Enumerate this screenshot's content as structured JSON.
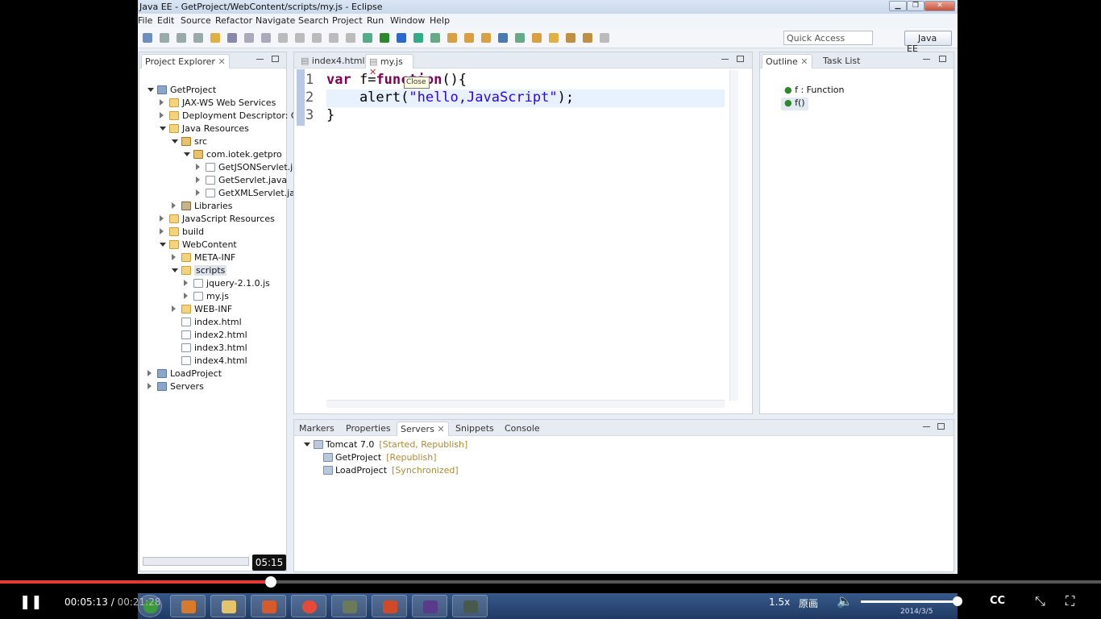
{
  "window": {
    "title": "Java EE - GetProject/WebContent/scripts/my.js - Eclipse"
  },
  "menu": [
    "File",
    "Edit",
    "Source",
    "Refactor",
    "Navigate",
    "Search",
    "Project",
    "Run",
    "Window",
    "Help"
  ],
  "toolbar": {
    "quick_access_placeholder": "Quick Access",
    "perspective": "Java EE"
  },
  "project_explorer": {
    "tab": "Project Explorer",
    "tree": [
      {
        "label": "GetProject",
        "level": 0,
        "open": true,
        "icon": "project"
      },
      {
        "label": "JAX-WS Web Services",
        "level": 1,
        "open": false,
        "icon": "folder"
      },
      {
        "label": "Deployment Descriptor: Ge",
        "level": 1,
        "open": false,
        "icon": "folder"
      },
      {
        "label": "Java Resources",
        "level": 1,
        "open": true,
        "icon": "folder"
      },
      {
        "label": "src",
        "level": 2,
        "open": true,
        "icon": "package-folder"
      },
      {
        "label": "com.iotek.getpro",
        "level": 3,
        "open": true,
        "icon": "package"
      },
      {
        "label": "GetJSONServlet.ja",
        "level": 4,
        "open": false,
        "icon": "file"
      },
      {
        "label": "GetServlet.java",
        "level": 4,
        "open": false,
        "icon": "file"
      },
      {
        "label": "GetXMLServlet.jav",
        "level": 4,
        "open": false,
        "icon": "file"
      },
      {
        "label": "Libraries",
        "level": 2,
        "open": false,
        "icon": "library"
      },
      {
        "label": "JavaScript Resources",
        "level": 1,
        "open": false,
        "icon": "folder"
      },
      {
        "label": "build",
        "level": 1,
        "open": false,
        "icon": "folder"
      },
      {
        "label": "WebContent",
        "level": 1,
        "open": true,
        "icon": "folder"
      },
      {
        "label": "META-INF",
        "level": 2,
        "open": false,
        "icon": "folder"
      },
      {
        "label": "scripts",
        "level": 2,
        "open": true,
        "icon": "folder",
        "selected": true
      },
      {
        "label": "jquery-2.1.0.js",
        "level": 3,
        "open": false,
        "icon": "file"
      },
      {
        "label": "my.js",
        "level": 3,
        "open": false,
        "icon": "file"
      },
      {
        "label": "WEB-INF",
        "level": 2,
        "open": false,
        "icon": "folder"
      },
      {
        "label": "index.html",
        "level": 2,
        "icon": "file"
      },
      {
        "label": "index2.html",
        "level": 2,
        "icon": "file"
      },
      {
        "label": "index3.html",
        "level": 2,
        "icon": "file"
      },
      {
        "label": "index4.html",
        "level": 2,
        "icon": "file"
      },
      {
        "label": "LoadProject",
        "level": 0,
        "open": false,
        "icon": "project"
      },
      {
        "label": "Servers",
        "level": 0,
        "open": false,
        "icon": "project"
      }
    ]
  },
  "editor": {
    "tabs": [
      {
        "label": "index4.html",
        "active": false
      },
      {
        "label": "my.js",
        "active": true
      }
    ],
    "tooltip": "Close",
    "lines": [
      {
        "num": "1",
        "code": [
          {
            "t": "var",
            "c": "kw"
          },
          {
            "t": " f=",
            "c": ""
          },
          {
            "t": "function",
            "c": "kw"
          },
          {
            "t": "(){",
            "c": ""
          }
        ]
      },
      {
        "num": "2",
        "code": [
          {
            "t": "    alert(",
            "c": ""
          },
          {
            "t": "\"hello,JavaScript\"",
            "c": "str"
          },
          {
            "t": ");",
            "c": ""
          }
        ]
      },
      {
        "num": "3",
        "code": [
          {
            "t": "}",
            "c": ""
          }
        ]
      }
    ]
  },
  "outline": {
    "tabs": [
      "Outline",
      "Task List"
    ],
    "items": [
      "f : Function",
      "f()"
    ]
  },
  "bottom": {
    "tabs": [
      "Markers",
      "Properties",
      "Servers",
      "Snippets",
      "Console"
    ],
    "servers": [
      {
        "name": "Tomcat 7.0",
        "status": "[Started, Republish]",
        "level": 0
      },
      {
        "name": "GetProject",
        "status": "[Republish]",
        "level": 1
      },
      {
        "name": "LoadProject",
        "status": "[Synchronized]",
        "level": 1
      }
    ]
  },
  "video": {
    "hover_time": "05:15",
    "current": "00:05:13",
    "total": "00:21:28",
    "progress": 0.246,
    "speed": "1.5x",
    "quality": "原画",
    "cc": "CC",
    "date": "2014/3/5"
  }
}
